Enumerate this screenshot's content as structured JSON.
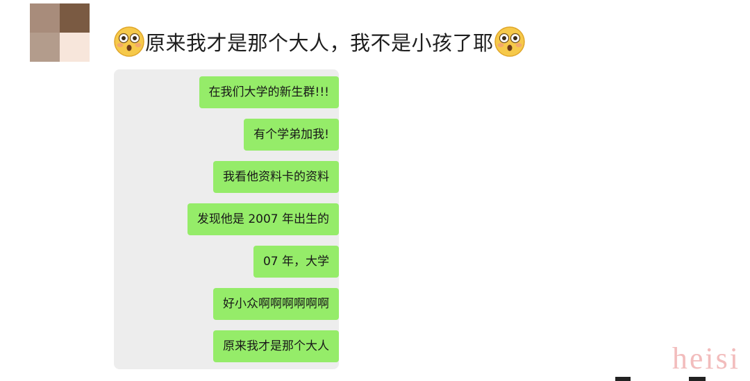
{
  "post": {
    "text": "原来我才是那个大人，我不是小孩了耶",
    "emoji_name": "flushed-face-icon",
    "avatar_colors": [
      "#a88c7b",
      "#7a5a42",
      "#b39c8c",
      "#f7e6db"
    ]
  },
  "chat": {
    "bubble_color": "#95ec69",
    "background_color": "#ededed",
    "messages": [
      {
        "text": "在我们大学的新生群!!!"
      },
      {
        "text": "有个学弟加我!"
      },
      {
        "text": "我看他资料卡的资料"
      },
      {
        "text": "发现他是 2007 年出生的"
      },
      {
        "text": "07 年，大学"
      },
      {
        "text": "好小众啊啊啊啊啊啊"
      },
      {
        "text": "原来我才是那个大人"
      }
    ]
  },
  "watermark": {
    "text": "heisi",
    "color": "#f2bcbc"
  }
}
